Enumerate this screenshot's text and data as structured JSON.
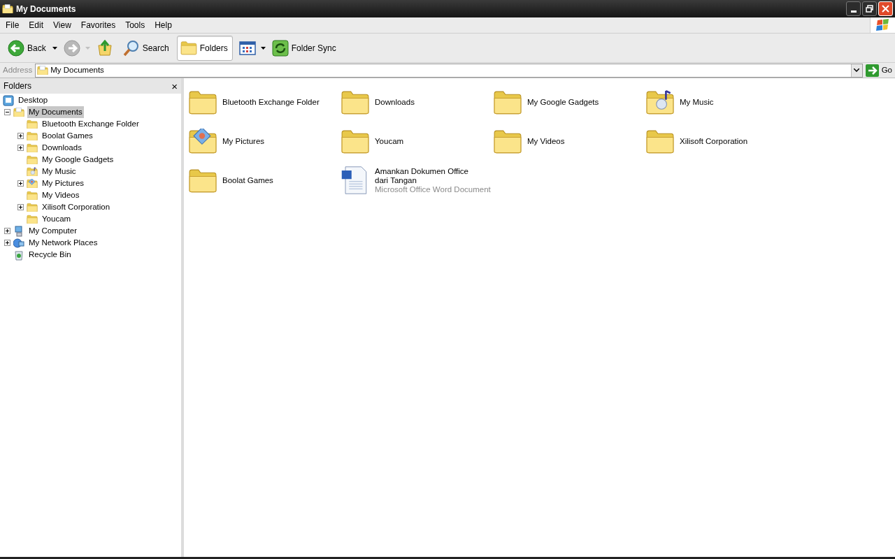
{
  "window": {
    "title": "My Documents"
  },
  "menu": [
    "File",
    "Edit",
    "View",
    "Favorites",
    "Tools",
    "Help"
  ],
  "toolbar": [
    {
      "kind": "back",
      "label": "Back",
      "pressed": false
    },
    {
      "kind": "forward",
      "disabled": true,
      "pressed": false
    },
    {
      "kind": "up",
      "pressed": false
    },
    {
      "kind": "search",
      "label": "Search",
      "pressed": false
    },
    {
      "kind": "folders",
      "label": "Folders",
      "pressed": true
    },
    {
      "kind": "views",
      "pressed": false
    },
    {
      "kind": "sync",
      "label": "Folder Sync",
      "pressed": false
    }
  ],
  "address": {
    "label": "Address",
    "value": "My Documents",
    "go": "Go"
  },
  "folders_pane": {
    "title": "Folders",
    "close": "×",
    "tree": [
      {
        "label": "Desktop",
        "kind": "desktop",
        "selected": false,
        "children": [
          {
            "label": "My Documents",
            "kind": "documents",
            "selected": true,
            "expanded": true,
            "children": [
              {
                "label": "Bluetooth Exchange Folder",
                "kind": "folder",
                "selected": false
              },
              {
                "label": "Boolat Games",
                "kind": "folder",
                "selected": false,
                "expanded": false
              },
              {
                "label": "Downloads",
                "kind": "folder",
                "selected": false,
                "expanded": false
              },
              {
                "label": "My Google Gadgets",
                "kind": "folder",
                "selected": false
              },
              {
                "label": "My Music",
                "kind": "music",
                "selected": false
              },
              {
                "label": "My Pictures",
                "kind": "pictures",
                "selected": false,
                "expanded": false
              },
              {
                "label": "My Videos",
                "kind": "folder",
                "selected": false
              },
              {
                "label": "Xilisoft Corporation",
                "kind": "folder",
                "selected": false,
                "expanded": false
              },
              {
                "label": "Youcam",
                "kind": "folder",
                "selected": false
              }
            ]
          },
          {
            "label": "My Computer",
            "kind": "computer",
            "selected": false,
            "expanded": false
          },
          {
            "label": "My Network Places",
            "kind": "network",
            "selected": false,
            "expanded": false
          },
          {
            "label": "Recycle Bin",
            "kind": "recycle",
            "selected": false
          }
        ]
      }
    ]
  },
  "files": [
    {
      "name": "Bluetooth Exchange Folder",
      "kind": "folder"
    },
    {
      "name": "Downloads",
      "kind": "folder"
    },
    {
      "name": "My Google Gadgets",
      "kind": "folder"
    },
    {
      "name": "My Music",
      "kind": "music"
    },
    {
      "name": "My Pictures",
      "kind": "pictures"
    },
    {
      "name": "Youcam",
      "kind": "folder"
    },
    {
      "name": "My Videos",
      "kind": "folder"
    },
    {
      "name": "Xilisoft Corporation",
      "kind": "folder"
    },
    {
      "name": "Boolat Games",
      "kind": "folder"
    },
    {
      "name": "Amankan Dokumen Office dari Tangan",
      "kind": "document",
      "type": "Microsoft Office Word Document"
    }
  ]
}
